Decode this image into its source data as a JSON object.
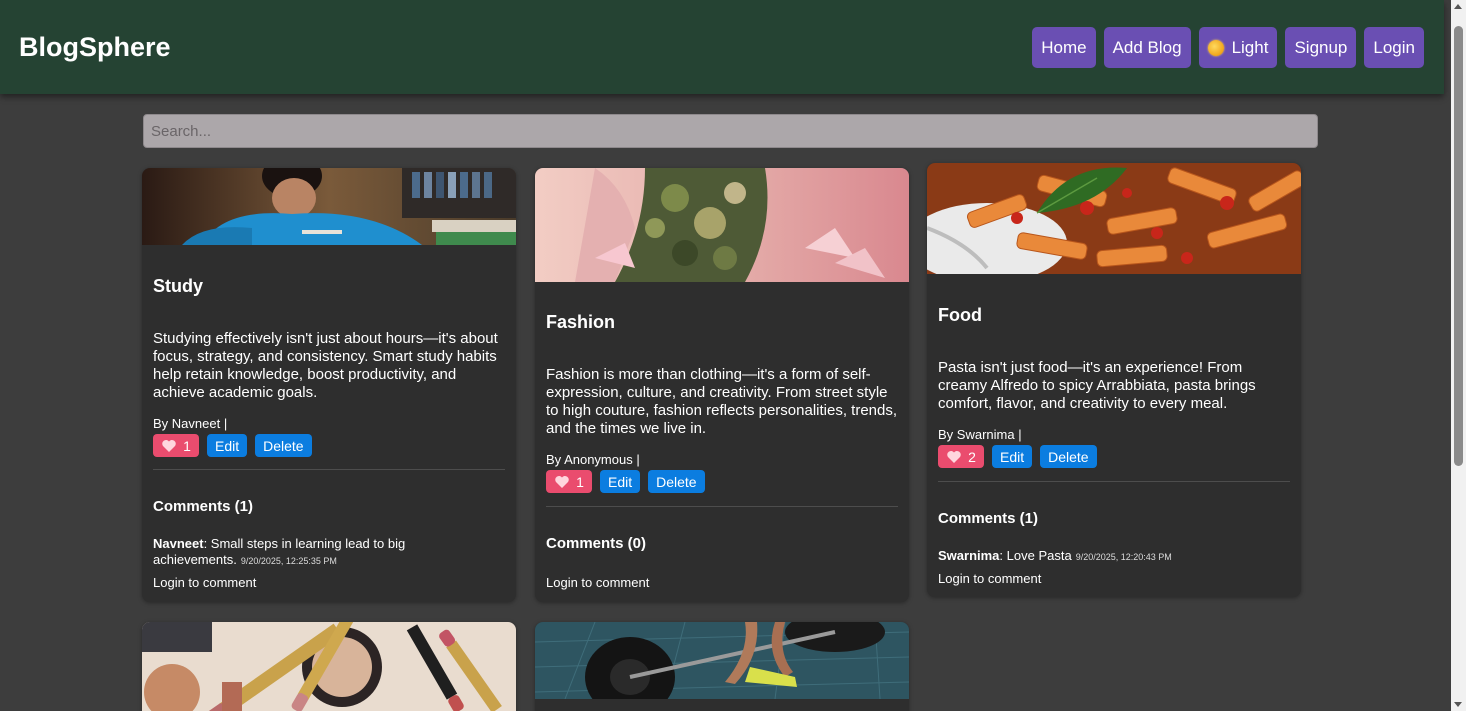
{
  "header": {
    "brand": "BlogSphere"
  },
  "nav": {
    "home": "Home",
    "add_blog": "Add Blog",
    "theme": "Light",
    "signup": "Signup",
    "login": "Login"
  },
  "search": {
    "placeholder": "Search..."
  },
  "colors": {
    "navbar": "#254333",
    "nav_button": "#6a4fb3",
    "like": "#ea4c6e",
    "action": "#0b7de0",
    "background": "#3d3d3d",
    "card": "#2e2e2e"
  },
  "posts": [
    {
      "title": "Study",
      "text": "Studying effectively isn't just about hours—it's about focus, strategy, and consistency. Smart study habits help retain knowledge, boost productivity, and achieve academic goals.",
      "byline": "By Navneet |",
      "likes": "1",
      "edit": "Edit",
      "delete": "Delete",
      "comments_title": "Comments (1)",
      "comments": [
        {
          "author": "Navneet",
          "text": ": Small steps in learning lead to big achievements.",
          "time": "9/20/2025, 12:25:35 PM"
        }
      ],
      "login_prompt": "Login to comment"
    },
    {
      "title": "Fashion",
      "text": "Fashion is more than clothing—it's a form of self-expression, culture, and creativity. From street style to high couture, fashion reflects personalities, trends, and the times we live in.",
      "byline": "By Anonymous |",
      "likes": "1",
      "edit": "Edit",
      "delete": "Delete",
      "comments_title": "Comments (0)",
      "comments": [],
      "login_prompt": "Login to comment"
    },
    {
      "title": "Food",
      "text": "Pasta isn't just food—it's an experience! From creamy Alfredo to spicy Arrabbiata, pasta brings comfort, flavor, and creativity to every meal.",
      "byline": "By Swarnima |",
      "likes": "2",
      "edit": "Edit",
      "delete": "Delete",
      "comments_title": "Comments (1)",
      "comments": [
        {
          "author": "Swarnima",
          "text": ": Love Pasta",
          "time": "9/20/2025, 12:20:43 PM"
        }
      ],
      "login_prompt": "Login to comment"
    }
  ]
}
